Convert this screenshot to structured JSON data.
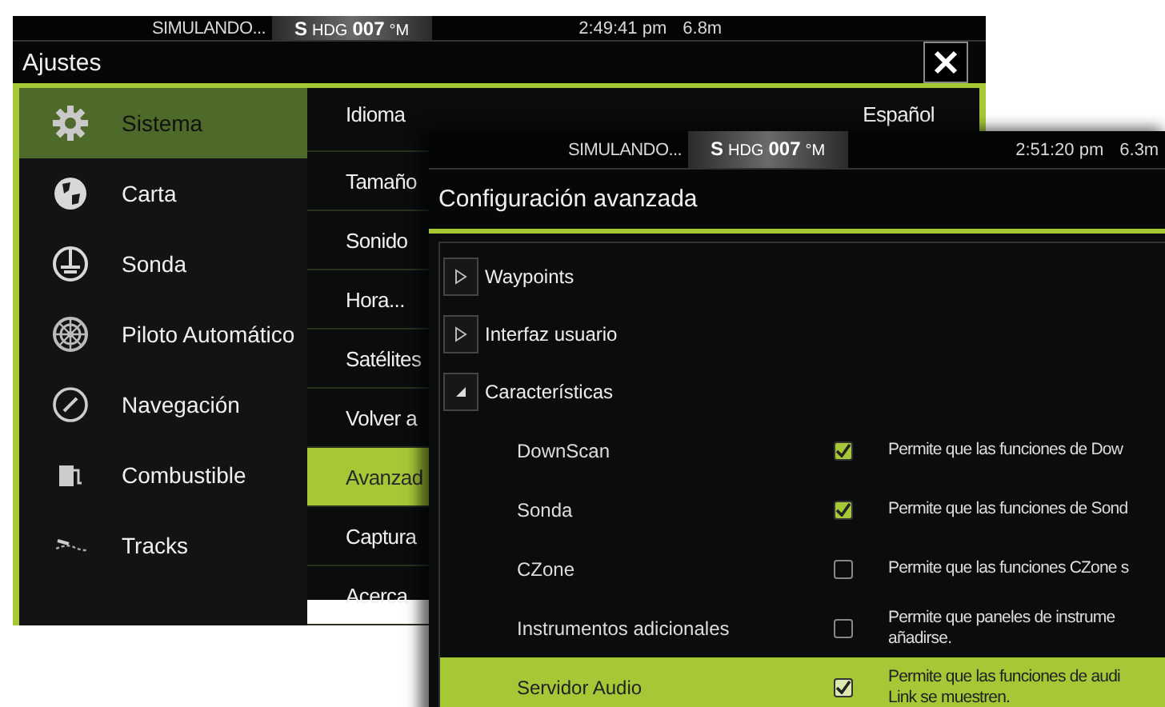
{
  "back_window": {
    "status_bar": {
      "mode": "SIMULANDO...",
      "heading_prefix": "S",
      "heading_label": "HDG",
      "heading_value": "007",
      "heading_unit": "°M",
      "time": "2:49:41 pm",
      "depth": "6.8m"
    },
    "title": "Ajustes",
    "sidebar": {
      "items": [
        {
          "label": "Sistema",
          "selected": true
        },
        {
          "label": "Carta",
          "selected": false
        },
        {
          "label": "Sonda",
          "selected": false
        },
        {
          "label": "Piloto Automático",
          "selected": false
        },
        {
          "label": "Navegación",
          "selected": false
        },
        {
          "label": "Combustible",
          "selected": false
        },
        {
          "label": "Tracks",
          "selected": false
        }
      ]
    },
    "settings": {
      "items": [
        {
          "label": "Idioma",
          "value": "Español",
          "selected": false
        },
        {
          "label": "Tamaño",
          "selected": false
        },
        {
          "label": "Sonido",
          "selected": false
        },
        {
          "label": "Hora...",
          "selected": false
        },
        {
          "label": "Satélites",
          "selected": false
        },
        {
          "label": "Volver a",
          "selected": false
        },
        {
          "label": "Avanzad",
          "selected": true
        },
        {
          "label": "Captura",
          "selected": false
        },
        {
          "label": "Acerca",
          "selected": false
        }
      ]
    }
  },
  "front_window": {
    "status_bar": {
      "mode": "SIMULANDO...",
      "heading_prefix": "S",
      "heading_label": "HDG",
      "heading_value": "007",
      "heading_unit": "°M",
      "time": "2:51:20 pm",
      "depth": "6.3m"
    },
    "title": "Configuración avanzada",
    "tree": [
      {
        "label": "Waypoints",
        "expanded": false
      },
      {
        "label": "Interfaz usuario",
        "expanded": false
      },
      {
        "label": "Características",
        "expanded": true,
        "children": [
          {
            "label": "DownScan",
            "checked": true,
            "selected": false,
            "description": [
              "Permite que las funciones de Dow"
            ]
          },
          {
            "label": "Sonda",
            "checked": true,
            "selected": false,
            "description": [
              "Permite que las funciones de Sond"
            ]
          },
          {
            "label": "CZone",
            "checked": false,
            "selected": false,
            "description": [
              "Permite que las funciones CZone s"
            ]
          },
          {
            "label": "Instrumentos adicionales",
            "checked": false,
            "selected": false,
            "description": [
              "Permite que paneles de instrume",
              "añadirse."
            ]
          },
          {
            "label": "Servidor Audio",
            "checked": true,
            "selected": true,
            "description": [
              "Permite que las funciones de audi",
              "Link se muestren."
            ]
          }
        ]
      }
    ]
  }
}
